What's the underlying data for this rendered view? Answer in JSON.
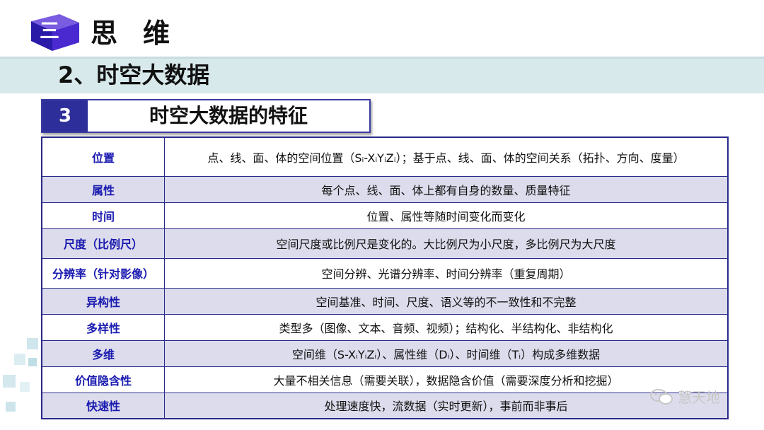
{
  "header": {
    "chapter_number": "三",
    "chapter_title": "思维"
  },
  "subtitle": "2、时空大数据",
  "section": {
    "number": "3",
    "title": "时空大数据的特征"
  },
  "table": {
    "rows": [
      {
        "label": "位置",
        "value": "点、线、面、体的空间位置（Sᵢ-XᵢYᵢZᵢ）；基于点、线、面、体的空间关系（拓扑、方向、度量）"
      },
      {
        "label": "属性",
        "value": "每个点、线、面、体上都有自身的数量、质量特征"
      },
      {
        "label": "时间",
        "value": "位置、属性等随时间变化而变化"
      },
      {
        "label": "尺度（比例尺）",
        "value": "空间尺度或比例尺是变化的。大比例尺为小尺度，多比例尺为大尺度"
      },
      {
        "label": "分辨率（针对影像）",
        "value": "空间分辨、光谱分辨率、时间分辨率（重复周期）"
      },
      {
        "label": "异构性",
        "value": "空间基准、时间、尺度、语义等的不一致性和不完整"
      },
      {
        "label": "多样性",
        "value": "类型多（图像、文本、音频、视频）；结构化、半结构化、非结构化"
      },
      {
        "label": "多维",
        "value": "空间维（S-XᵢYᵢZᵢ）、属性维（Dᵢ）、时间维（Tᵢ）构成多维数据"
      },
      {
        "label": "价值隐含性",
        "value": "大量不相关信息（需要关联），数据隐含价值（需要深度分析和挖掘）"
      },
      {
        "label": "快速性",
        "value": "处理速度快，流数据（实时更新），事前而非事后"
      }
    ]
  },
  "watermark": "慧天地"
}
